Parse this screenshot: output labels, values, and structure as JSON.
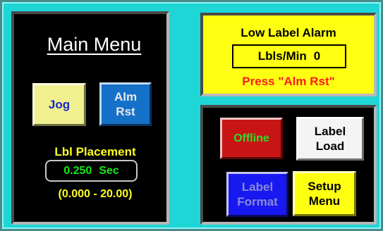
{
  "main_panel": {
    "title": "Main Menu",
    "jog_label": "Jog",
    "alm_rst_line1": "Alm",
    "alm_rst_line2": "Rst",
    "placement_label": "Lbl Placement",
    "placement_value": "0.250",
    "placement_unit": "Sec",
    "placement_range": "(0.000 - 20.00)"
  },
  "alarm_panel": {
    "title": "Low Label Alarm",
    "rate_label": "Lbls/Min",
    "rate_value": "0",
    "instruction": "Press \"Alm Rst\""
  },
  "button_panel": {
    "offline_label": "Offline",
    "label_load_line1": "Label",
    "label_load_line2": "Load",
    "label_format_line1": "Label",
    "label_format_line2": "Format",
    "setup_line1": "Setup",
    "setup_line2": "Menu"
  },
  "colors": {
    "background": "#1fd6d6",
    "panel": "#000000",
    "alarm_panel": "#ffff11",
    "offline_button": "#c81414",
    "label_format_button": "#1818f0",
    "alm_rst_button": "#1570c8",
    "jog_button": "#f0f090",
    "value_text": "#18e818",
    "alarm_text": "#ff1a1a"
  }
}
